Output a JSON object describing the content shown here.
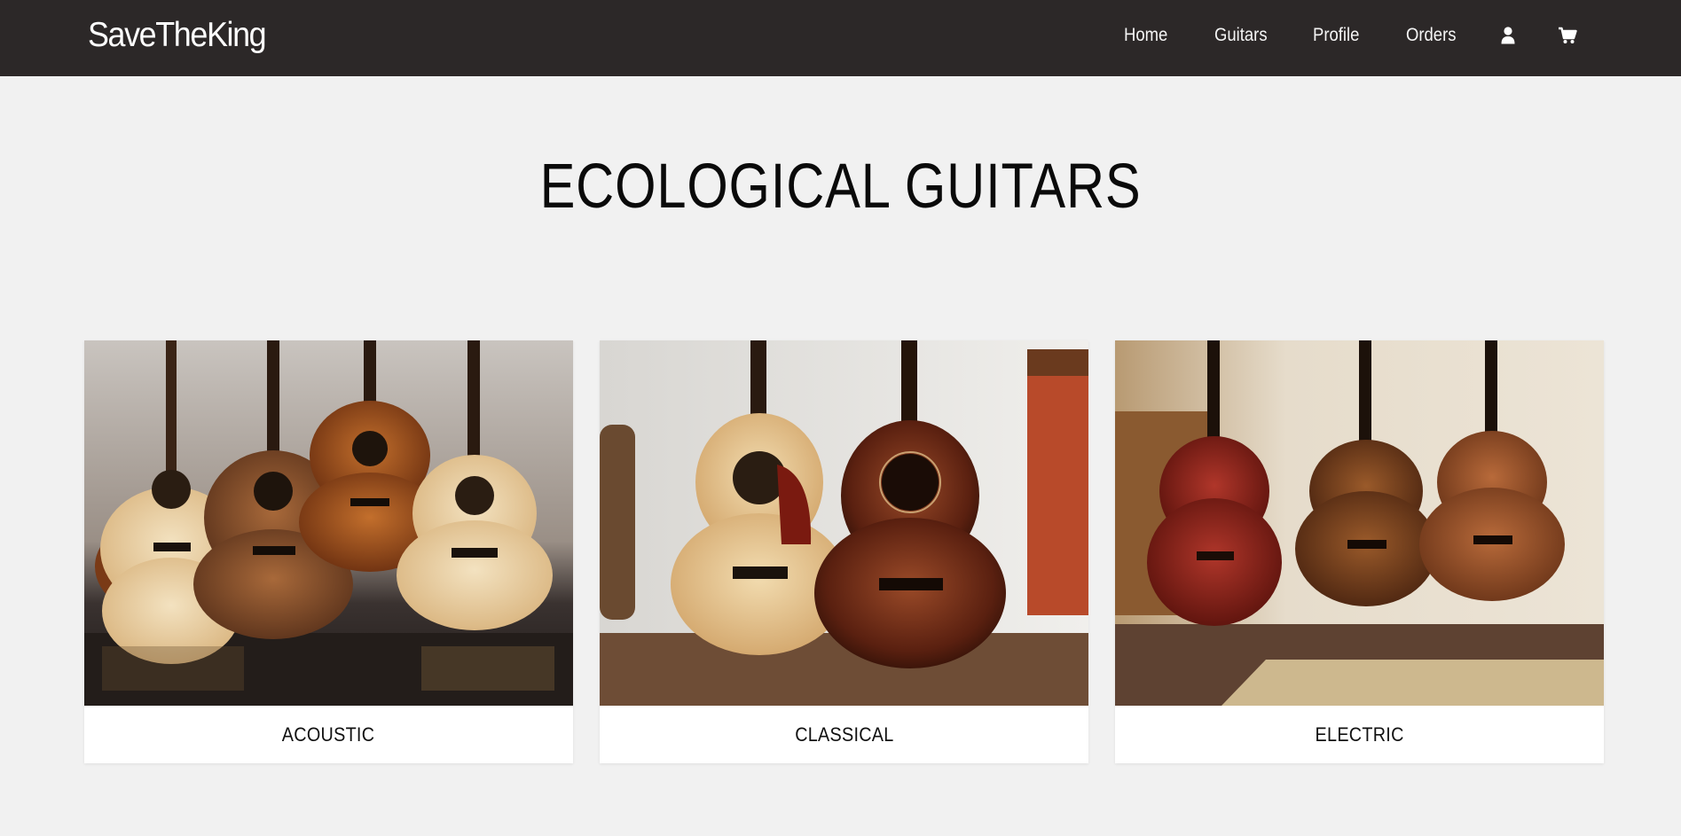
{
  "navbar": {
    "brand": "SaveTheKing",
    "links": [
      {
        "label": "Home"
      },
      {
        "label": "Guitars"
      },
      {
        "label": "Profile"
      },
      {
        "label": "Orders"
      }
    ],
    "icons": [
      "user-icon",
      "cart-icon"
    ],
    "background": "#2c2828"
  },
  "main": {
    "title": "ECOLOGICAL GUITARS",
    "categories": [
      {
        "label": "ACOUSTIC",
        "image": "acoustic-guitars-image"
      },
      {
        "label": "CLASSICAL",
        "image": "classical-guitars-image"
      },
      {
        "label": "ELECTRIC",
        "image": "electric-guitars-image"
      }
    ]
  },
  "colors": {
    "page_background": "#f1f1f1",
    "card_background": "#ffffff",
    "text": "#111111"
  }
}
